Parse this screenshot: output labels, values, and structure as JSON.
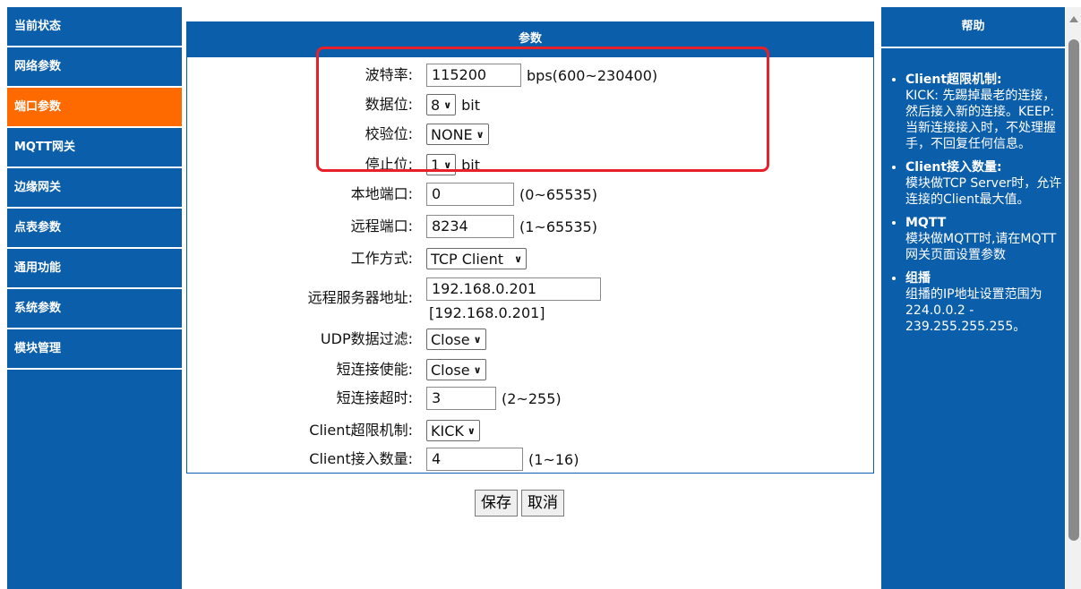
{
  "nav": {
    "items": [
      {
        "label": "当前状态",
        "active": false
      },
      {
        "label": "网络参数",
        "active": false
      },
      {
        "label": "端口参数",
        "active": true
      },
      {
        "label": "MQTT网关",
        "active": false
      },
      {
        "label": "边缘网关",
        "active": false
      },
      {
        "label": "点表参数",
        "active": false
      },
      {
        "label": "通用功能",
        "active": false
      },
      {
        "label": "系统参数",
        "active": false
      },
      {
        "label": "模块管理",
        "active": false
      }
    ]
  },
  "main": {
    "title": "参数",
    "baud": {
      "label": "波特率:",
      "value": "115200",
      "hint": "bps(600~230400)"
    },
    "databits": {
      "label": "数据位:",
      "value": "8",
      "unit": "bit"
    },
    "parity": {
      "label": "校验位:",
      "value": "NONE"
    },
    "stopbits": {
      "label": "停止位:",
      "value": "1",
      "unit": "bit"
    },
    "local_port": {
      "label": "本地端口:",
      "value": "0",
      "hint": "(0~65535)"
    },
    "remote_port": {
      "label": "远程端口:",
      "value": "8234",
      "hint": "(1~65535)"
    },
    "work_mode": {
      "label": "工作方式:",
      "value": "TCP Client"
    },
    "server_addr": {
      "label": "远程服务器地址:",
      "value": "192.168.0.201",
      "current": "[192.168.0.201]"
    },
    "udp_filter": {
      "label": "UDP数据过滤:",
      "value": "Close"
    },
    "short_conn": {
      "label": "短连接使能:",
      "value": "Close"
    },
    "short_timeout": {
      "label": "短连接超时:",
      "value": "3",
      "hint": "(2~255)"
    },
    "client_limit": {
      "label": "Client超限机制:",
      "value": "KICK"
    },
    "client_count": {
      "label": "Client接入数量:",
      "value": "4",
      "hint": "(1~16)"
    },
    "save_label": "保存",
    "cancel_label": "取消"
  },
  "help": {
    "title": "帮助",
    "items": [
      {
        "title": "Client超限机制:",
        "text": "KICK: 先踢掉最老的连接，然后接入新的连接。KEEP: 当新连接接入时，不处理握手，不回复任何信息。"
      },
      {
        "title": "Client接入数量:",
        "text": "模块做TCP Server时，允许连接的Client最大值。"
      },
      {
        "title": "MQTT",
        "text": "模块做MQTT时,请在MQTT网关页面设置参数"
      },
      {
        "title": "组播",
        "text": "组播的IP地址设置范围为224.0.0.2 - 239.255.255.255。"
      }
    ]
  },
  "colors": {
    "nav_bg": "#0b5eaa",
    "active": "#ff6a00",
    "highlight": "#e8202a"
  }
}
